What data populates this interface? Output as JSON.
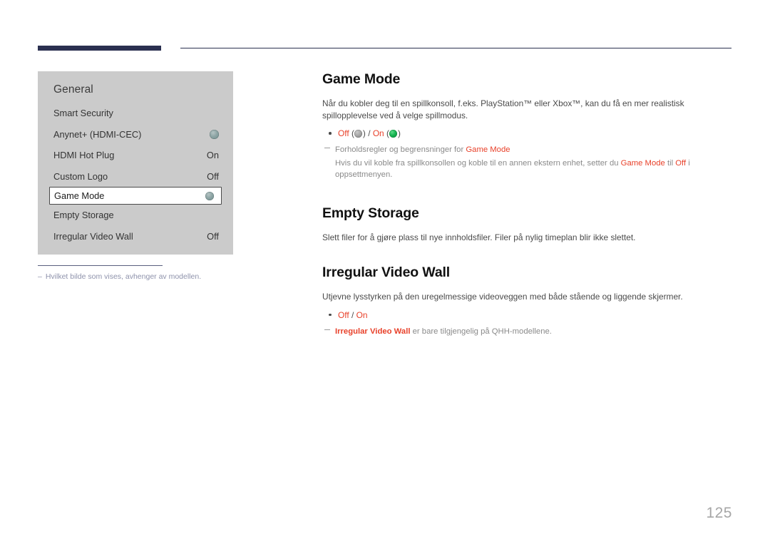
{
  "header": {
    "accent_color": "#2b3050"
  },
  "osd_panel": {
    "title": "General",
    "items": [
      {
        "label": "Smart Security",
        "value": "",
        "indicator": "none",
        "selected": false
      },
      {
        "label": "Anynet+ (HDMI-CEC)",
        "value": "",
        "indicator": "toggle-dot",
        "selected": false
      },
      {
        "label": "HDMI Hot Plug",
        "value": "On",
        "indicator": "none",
        "selected": false
      },
      {
        "label": "Custom Logo",
        "value": "Off",
        "indicator": "none",
        "selected": false
      },
      {
        "label": "Game Mode",
        "value": "",
        "indicator": "toggle-dot",
        "selected": true
      },
      {
        "label": "Empty Storage",
        "value": "",
        "indicator": "none",
        "selected": false
      },
      {
        "label": "Irregular Video Wall",
        "value": "Off",
        "indicator": "none",
        "selected": false
      }
    ]
  },
  "panel_note": {
    "dash": "–",
    "text": "Hvilket bilde som vises, avhenger av modellen."
  },
  "sections": {
    "game_mode": {
      "title": "Game Mode",
      "body": "Når du kobler deg til en spillkonsoll, f.eks. PlayStation™ eller Xbox™, kan du få en mer realistisk spillopplevelse ved å velge spillmodus.",
      "option_off": "Off",
      "option_on": "On",
      "option_separator": "/",
      "note_heading_pre": "Forholdsregler og begrensninger for ",
      "note_heading_term": "Game Mode",
      "note_body_1": "Hvis du vil koble fra spillkonsollen og koble til en annen ekstern enhet, setter du ",
      "note_body_term_1": "Game Mode",
      "note_body_2": " til ",
      "note_body_term_2": "Off",
      "note_body_3": " i oppsettmenyen."
    },
    "empty_storage": {
      "title": "Empty Storage",
      "body": "Slett filer for å gjøre plass til nye innholdsfiler. Filer på nylig timeplan blir ikke slettet."
    },
    "irregular_video_wall": {
      "title": "Irregular Video Wall",
      "body": "Utjevne lysstyrken på den uregelmessige videoveggen med både stående og liggende skjermer.",
      "option_off": "Off",
      "option_on": "On",
      "option_separator": "/",
      "note_term": "Irregular Video Wall",
      "note_rest": " er bare tilgjengelig på QHH-modellene."
    }
  },
  "footer": {
    "page_number": "125"
  }
}
